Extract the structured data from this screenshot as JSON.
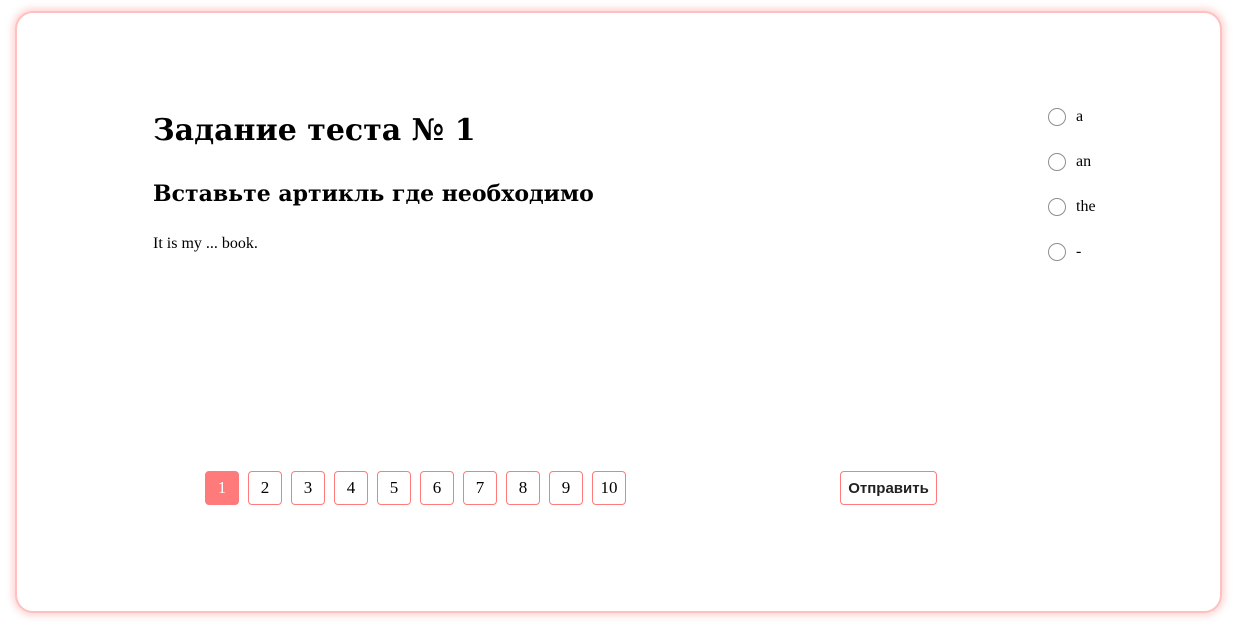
{
  "test": {
    "title": "Задание теста № 1",
    "instruction": "Вставьте артикль где необходимо",
    "question": "It is my ... book."
  },
  "options": [
    {
      "label": "a",
      "selected": false
    },
    {
      "label": "an",
      "selected": false
    },
    {
      "label": "the",
      "selected": false
    },
    {
      "label": "-",
      "selected": false
    }
  ],
  "pagination": {
    "current": "1",
    "pages": [
      "1",
      "2",
      "3",
      "4",
      "5",
      "6",
      "7",
      "8",
      "9",
      "10"
    ]
  },
  "submit": {
    "label": "Отправить"
  },
  "colors": {
    "accent": "#ff7b7b",
    "card_border": "#ffc0c0"
  }
}
